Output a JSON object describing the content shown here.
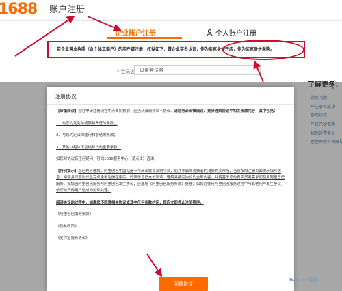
{
  "header": {
    "logo": "1688",
    "title": "账户注册"
  },
  "tabs": {
    "enterprise": "企业账户注册",
    "personal": "个人账户注册"
  },
  "notice": "若企业营业执照（含个体工商户）的用户请注册，权益如下：做企业实名认证；作为卖家身份开店；作为买家身份采购。",
  "form": {
    "member_label": "会员名",
    "member_placeholder": "设置会员名"
  },
  "sidebar": {
    "title": "了解更多：",
    "close": "×",
    "items": [
      "常见问题：",
      "户注册不成功",
      "提示短信",
      "户名已被使用",
      "如何设置会员",
      "巴巴开或公司账号"
    ]
  },
  "dialog": {
    "title": "注册协议",
    "p1_head": "【审慎阅读】",
    "p1_text": "您在申请注册流程中点击同意前，应当认真阅读以下协议。",
    "p1_bold": "请您务必审慎阅读、充分理解协议中相关条款内容，其中包括：",
    "item1": "1、与您约定免除或限制责任的条款；",
    "item2": "2、与您约定法律适用和管辖的条款；",
    "item3": "3、其他以粗体下划线标识的重要条款。",
    "contact": "如您对协议有任何疑问，可向1688服务中心（请点击）咨询",
    "p2_head": "【特别提示】",
    "p2_text": "您已充分理解，阿里巴巴中国站是一个商业贸易采购平台，而并非面向消费者的消费购买市场，当您按照注册页面提示填写信息、阅读并同意协议且完成全部注册程序后，即表示您已充分阅读、理解并接受协议的全部内容，并将基于您的真实贸易需求而使用阿里巴巴服务。如您因阿里巴巴服务与阿里巴巴发生争议，应适用《阿里巴巴服务条款》处理；如您在使用阿里巴巴服务过程中与其他用户发生争议，依您与其他用户达成的协议处理。",
    "p3": "阅读协议的过程中，如果您不同意相关协议或其中任何条款约定，您应立即停止注册程序。",
    "link1": "《阿里巴巴服务条款》",
    "link2": "《隐私政策》",
    "link3": "《支付宝服务协议》",
    "agree_label": "同意协议"
  },
  "watermark": "Bai du 经验",
  "colors": {
    "brand": "#ff6a00",
    "annotation": "#c8102e"
  }
}
